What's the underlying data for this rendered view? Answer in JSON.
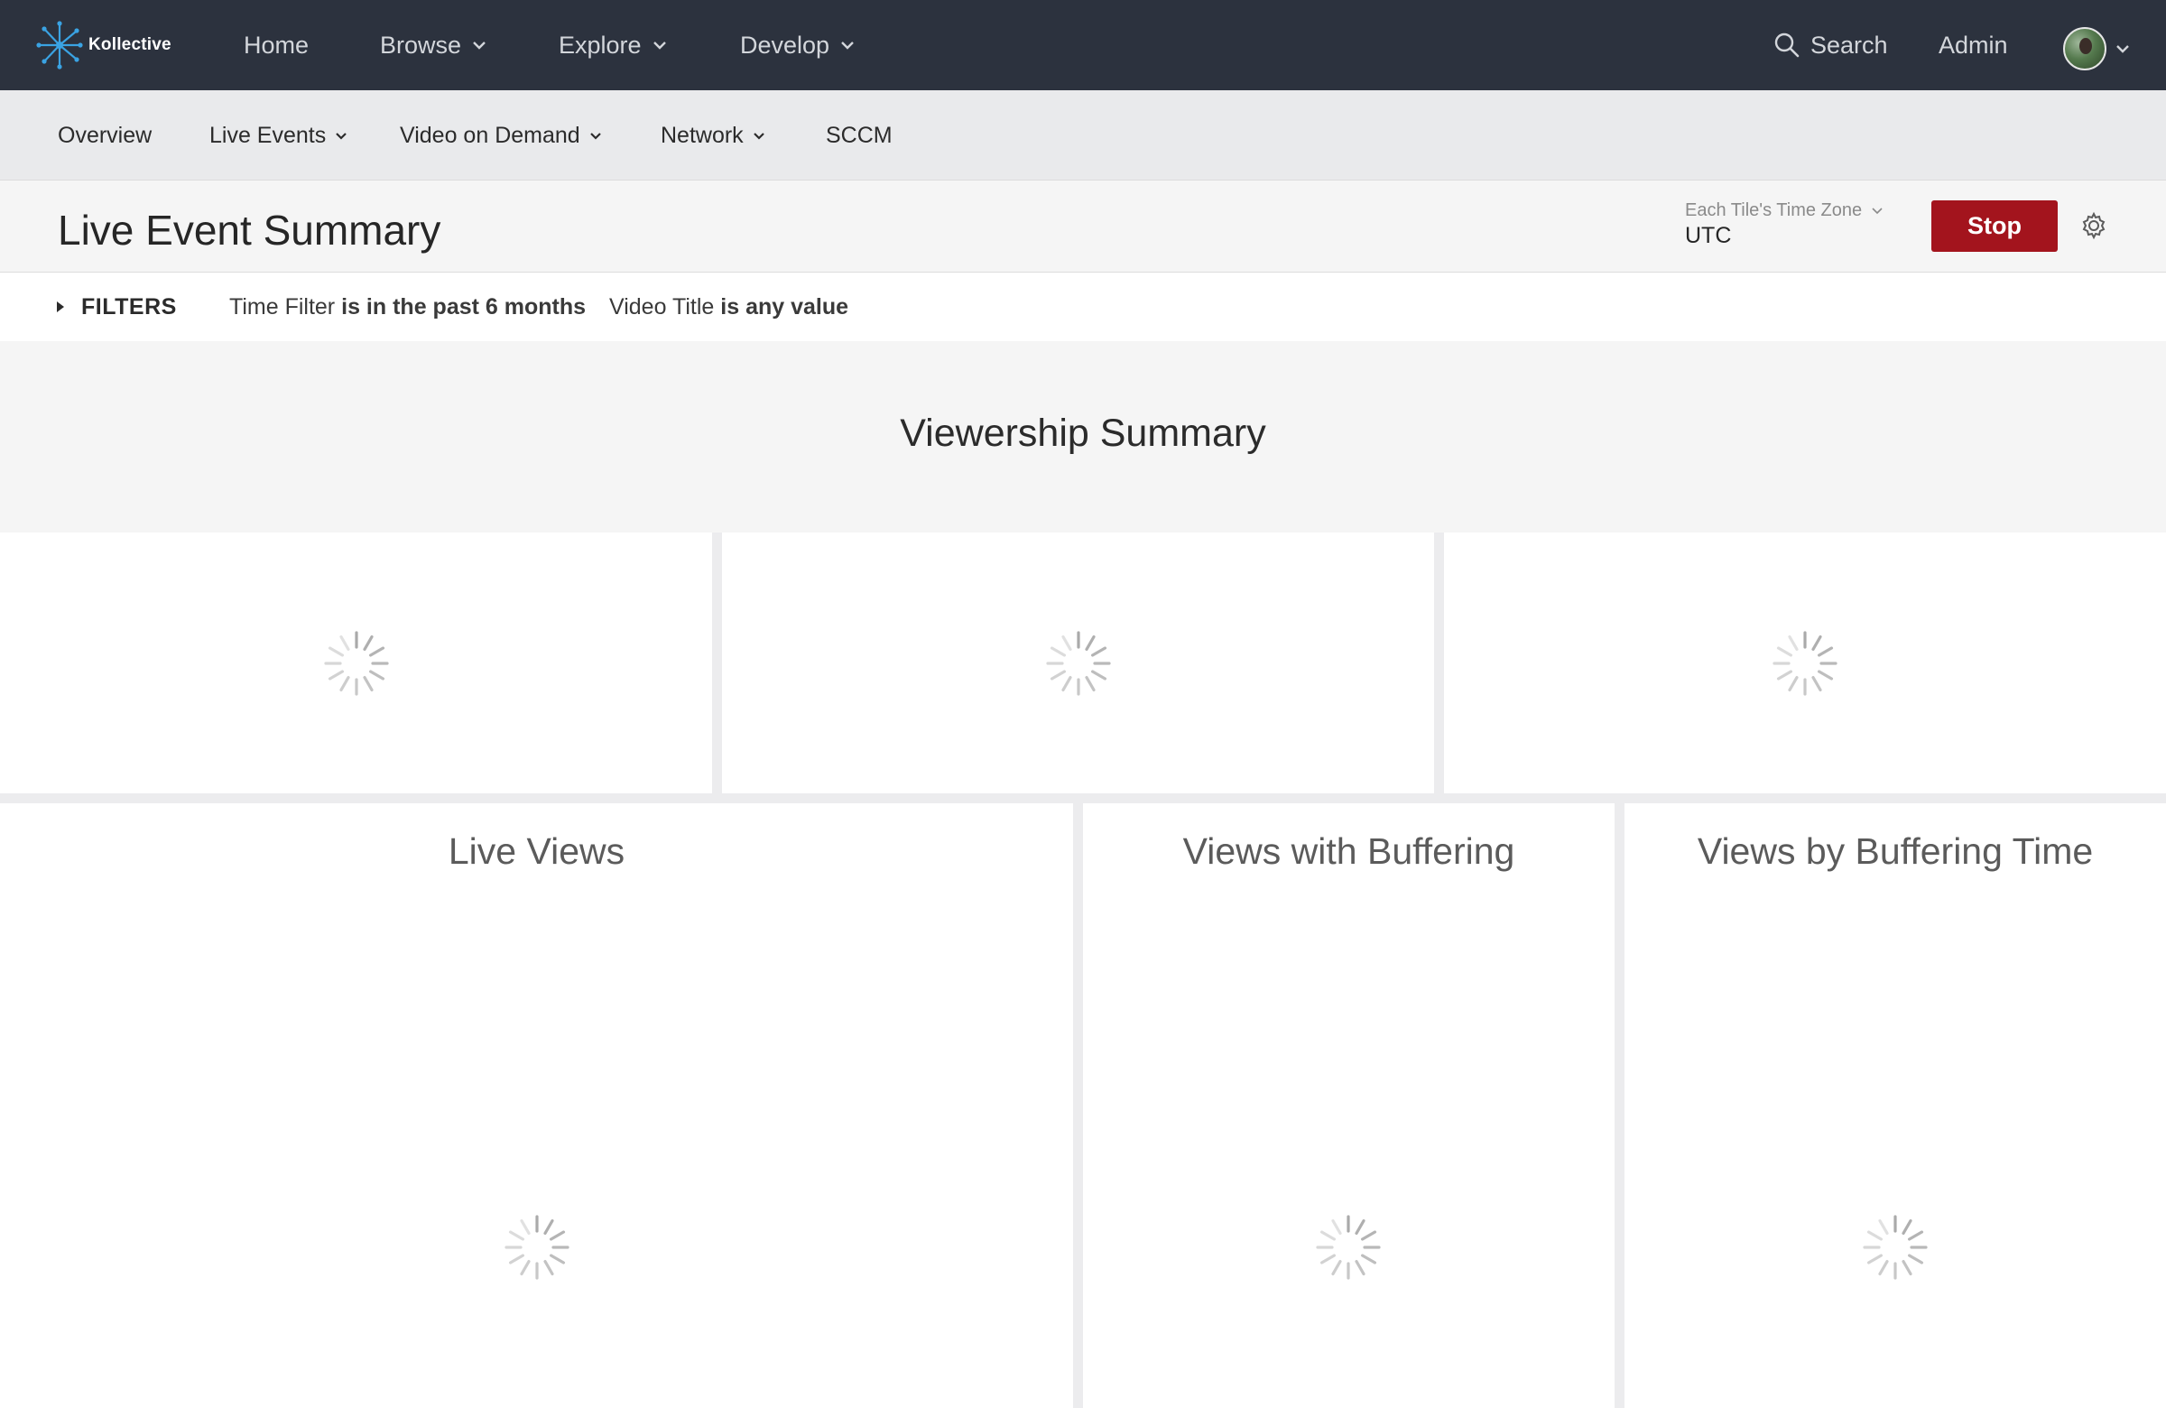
{
  "brand": {
    "name": "Kollective",
    "accent": "#3aa3e3"
  },
  "topnav": {
    "items": [
      {
        "label": "Home",
        "has_dropdown": false
      },
      {
        "label": "Browse",
        "has_dropdown": true
      },
      {
        "label": "Explore",
        "has_dropdown": true
      },
      {
        "label": "Develop",
        "has_dropdown": true
      }
    ],
    "search_label": "Search",
    "admin_label": "Admin"
  },
  "subnav": {
    "items": [
      {
        "label": "Overview",
        "has_dropdown": false
      },
      {
        "label": "Live Events",
        "has_dropdown": true
      },
      {
        "label": "Video on Demand",
        "has_dropdown": true
      },
      {
        "label": "Network",
        "has_dropdown": true
      },
      {
        "label": "SCCM",
        "has_dropdown": false
      }
    ]
  },
  "header": {
    "title": "Live Event Summary",
    "timezone_label": "Each Tile's Time Zone",
    "timezone_value": "UTC",
    "stop_label": "Stop",
    "stop_color": "#a3141d"
  },
  "filters": {
    "toggle_label": "FILTERS",
    "items": [
      {
        "field": "Time Filter",
        "condition": "is in the past 6 months"
      },
      {
        "field": "Video Title",
        "condition": "is any value"
      }
    ]
  },
  "dashboard": {
    "section_title": "Viewership Summary",
    "tiles": [
      {
        "title": "Live Views",
        "state": "loading"
      },
      {
        "title": "Views with Buffering",
        "state": "loading"
      },
      {
        "title": "Views by Buffering Time",
        "state": "loading"
      }
    ]
  }
}
